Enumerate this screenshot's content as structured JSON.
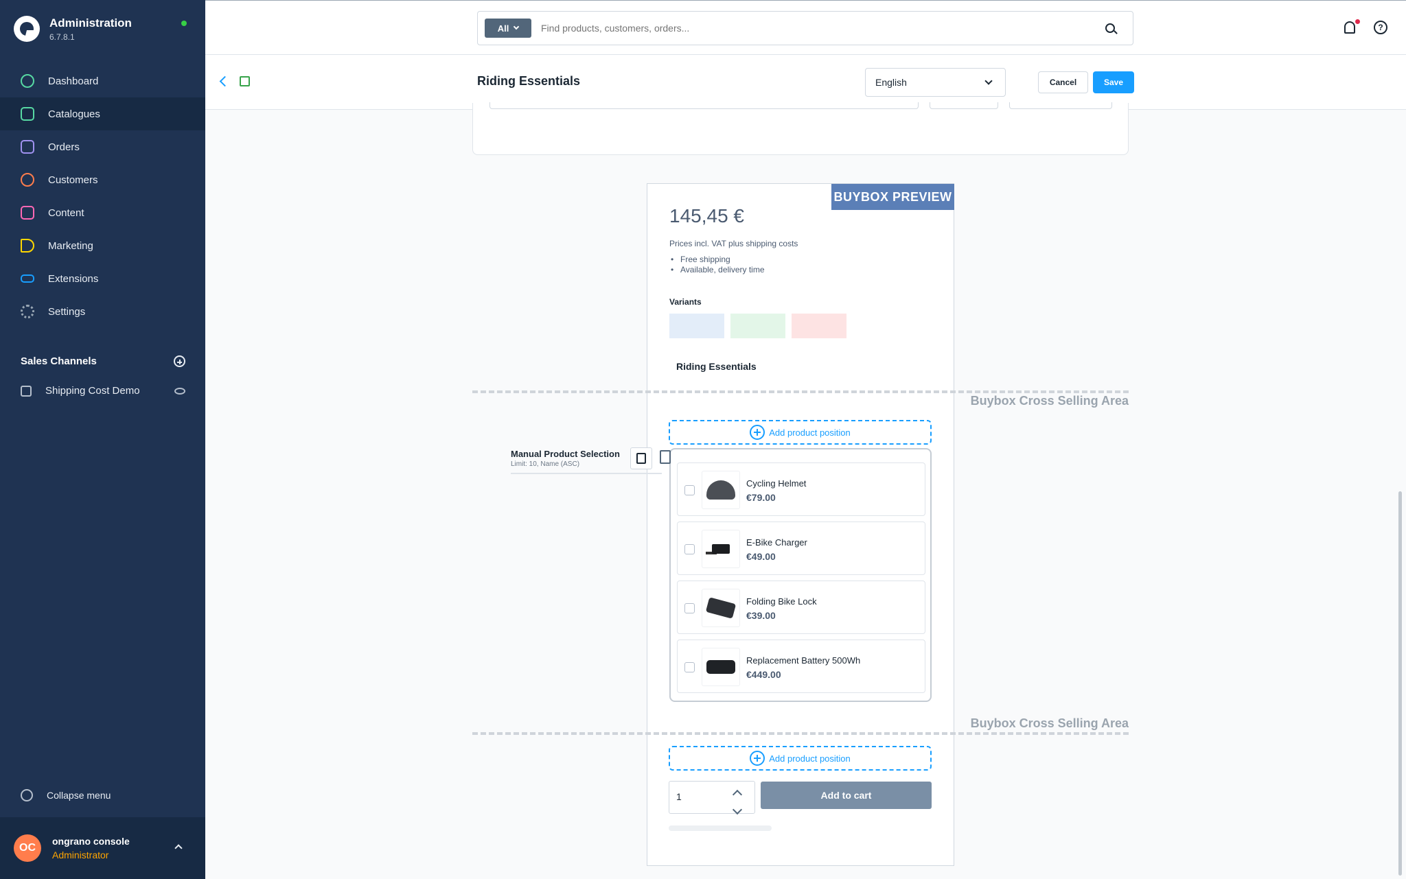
{
  "sidebar": {
    "brand_title": "Administration",
    "brand_version": "6.7.8.1",
    "nav": [
      {
        "label": "Dashboard",
        "icon": "dashboard-icon",
        "color": "#57d9a3"
      },
      {
        "label": "Catalogues",
        "icon": "catalogue-icon",
        "color": "#57d9a3"
      },
      {
        "label": "Orders",
        "icon": "orders-icon",
        "color": "#a092f0"
      },
      {
        "label": "Customers",
        "icon": "customers-icon",
        "color": "#ff7d4c"
      },
      {
        "label": "Content",
        "icon": "content-icon",
        "color": "#ff68b4"
      },
      {
        "label": "Marketing",
        "icon": "marketing-icon",
        "color": "#ffd700"
      },
      {
        "label": "Extensions",
        "icon": "extensions-icon",
        "color": "#189eff"
      },
      {
        "label": "Settings",
        "icon": "settings-icon",
        "color": "#9aa8b5"
      }
    ],
    "sales_channels_label": "Sales Channels",
    "sales_channel_item": "Shipping Cost Demo",
    "collapse_label": "Collapse menu",
    "user": {
      "initials": "OC",
      "name": "ongrano console",
      "role": "Administrator"
    }
  },
  "topbar": {
    "search_type": "All",
    "search_placeholder": "Find products, customers, orders...",
    "help_glyph": "?"
  },
  "smartbar": {
    "title": "Riding Essentials",
    "language": "English",
    "cancel_label": "Cancel",
    "save_label": "Save"
  },
  "buybox": {
    "tag": "BUYBOX PREVIEW",
    "price": "145,45 €",
    "tax_note": "Prices incl. VAT plus shipping costs",
    "features": [
      "Free shipping",
      "Available, delivery time"
    ],
    "variants_label": "Variants",
    "variant_colors": [
      "#e3edf9",
      "#e3f6e8",
      "#fde3e3"
    ],
    "product_name": "Riding Essentials",
    "area_label_1": "Buybox Cross Selling Area",
    "area_label_2": "Buybox Cross Selling Area",
    "add_position_label": "Add product position",
    "quantity": "1",
    "add_to_cart_label": "Add to cart"
  },
  "selection": {
    "title": "Manual Product Selection",
    "subtitle": "Limit: 10, Name (ASC)"
  },
  "products": [
    {
      "name": "Cycling Helmet",
      "price": "€79.00",
      "image": "helmet"
    },
    {
      "name": "E-Bike Charger",
      "price": "€49.00",
      "image": "charger"
    },
    {
      "name": "Folding Bike Lock",
      "price": "€39.00",
      "image": "lock"
    },
    {
      "name": "Replacement Battery 500Wh",
      "price": "€449.00",
      "image": "battery"
    }
  ]
}
